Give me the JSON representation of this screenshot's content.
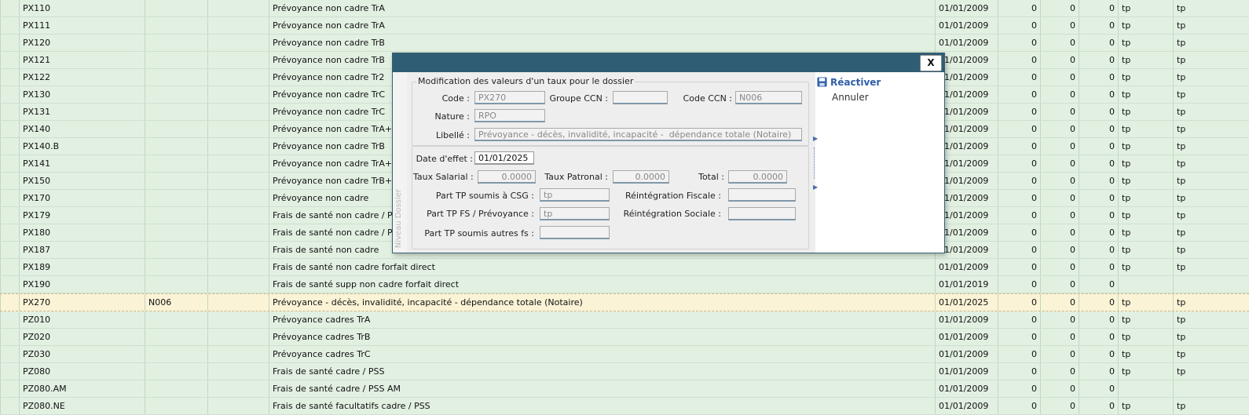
{
  "grid": {
    "rows": [
      {
        "code": "PX110",
        "ccn": "",
        "libelle": "Prévoyance non cadre TrA",
        "date": "01/01/2009",
        "v1": "0",
        "v2": "0",
        "v3": "0",
        "t1": "tp",
        "t2": "tp"
      },
      {
        "code": "PX111",
        "ccn": "",
        "libelle": "Prévoyance non cadre TrA",
        "date": "01/01/2009",
        "v1": "0",
        "v2": "0",
        "v3": "0",
        "t1": "tp",
        "t2": "tp"
      },
      {
        "code": "PX120",
        "ccn": "",
        "libelle": "Prévoyance non cadre TrB",
        "date": "01/01/2009",
        "v1": "0",
        "v2": "0",
        "v3": "0",
        "t1": "tp",
        "t2": "tp"
      },
      {
        "code": "PX121",
        "ccn": "",
        "libelle": "Prévoyance non cadre TrB",
        "date": "01/01/2009",
        "v1": "0",
        "v2": "0",
        "v3": "0",
        "t1": "tp",
        "t2": "tp"
      },
      {
        "code": "PX122",
        "ccn": "",
        "libelle": "Prévoyance non cadre Tr2",
        "date": "01/01/2009",
        "v1": "0",
        "v2": "0",
        "v3": "0",
        "t1": "tp",
        "t2": "tp"
      },
      {
        "code": "PX130",
        "ccn": "",
        "libelle": "Prévoyance non cadre TrC",
        "date": "01/01/2009",
        "v1": "0",
        "v2": "0",
        "v3": "0",
        "t1": "tp",
        "t2": "tp"
      },
      {
        "code": "PX131",
        "ccn": "",
        "libelle": "Prévoyance non cadre TrC",
        "date": "01/01/2009",
        "v1": "0",
        "v2": "0",
        "v3": "0",
        "t1": "tp",
        "t2": "tp"
      },
      {
        "code": "PX140",
        "ccn": "",
        "libelle": "Prévoyance non cadre TrA+TrB",
        "date": "01/01/2009",
        "v1": "0",
        "v2": "0",
        "v3": "0",
        "t1": "tp",
        "t2": "tp"
      },
      {
        "code": "PX140.B",
        "ccn": "",
        "libelle": "Prévoyance non cadre TrB",
        "date": "01/01/2009",
        "v1": "0",
        "v2": "0",
        "v3": "0",
        "t1": "tp",
        "t2": "tp"
      },
      {
        "code": "PX141",
        "ccn": "",
        "libelle": "Prévoyance non cadre TrA+TrB",
        "date": "01/01/2009",
        "v1": "0",
        "v2": "0",
        "v3": "0",
        "t1": "tp",
        "t2": "tp"
      },
      {
        "code": "PX150",
        "ccn": "",
        "libelle": "Prévoyance non cadre TrB+TrC",
        "date": "01/01/2009",
        "v1": "0",
        "v2": "0",
        "v3": "0",
        "t1": "tp",
        "t2": "tp"
      },
      {
        "code": "PX170",
        "ccn": "",
        "libelle": "Prévoyance non cadre",
        "date": "01/01/2009",
        "v1": "0",
        "v2": "0",
        "v3": "0",
        "t1": "tp",
        "t2": "tp"
      },
      {
        "code": "PX179",
        "ccn": "",
        "libelle": "Frais de santé non cadre / PSS",
        "date": "01/01/2009",
        "v1": "0",
        "v2": "0",
        "v3": "0",
        "t1": "tp",
        "t2": "tp"
      },
      {
        "code": "PX180",
        "ccn": "",
        "libelle": "Frais de santé non cadre / PSS",
        "date": "01/01/2009",
        "v1": "0",
        "v2": "0",
        "v3": "0",
        "t1": "tp",
        "t2": "tp"
      },
      {
        "code": "PX187",
        "ccn": "",
        "libelle": "Frais de santé non cadre",
        "date": "01/01/2009",
        "v1": "0",
        "v2": "0",
        "v3": "0",
        "t1": "tp",
        "t2": "tp"
      },
      {
        "code": "PX189",
        "ccn": "",
        "libelle": "Frais de santé non cadre forfait direct",
        "date": "01/01/2009",
        "v1": "0",
        "v2": "0",
        "v3": "0",
        "t1": "tp",
        "t2": "tp"
      },
      {
        "code": "PX190",
        "ccn": "",
        "libelle": "Frais de santé supp non cadre forfait direct",
        "date": "01/01/2019",
        "v1": "0",
        "v2": "0",
        "v3": "0",
        "t1": "",
        "t2": ""
      },
      {
        "code": "PX270",
        "ccn": "N006",
        "libelle": "Prévoyance - décès, invalidité, incapacité -  dépendance totale (Notaire)",
        "date": "01/01/2025",
        "v1": "0",
        "v2": "0",
        "v3": "0",
        "t1": "tp",
        "t2": "tp",
        "selected": true
      },
      {
        "code": "PZ010",
        "ccn": "",
        "libelle": "Prévoyance cadres TrA",
        "date": "01/01/2009",
        "v1": "0",
        "v2": "0",
        "v3": "0",
        "t1": "tp",
        "t2": "tp"
      },
      {
        "code": "PZ020",
        "ccn": "",
        "libelle": "Prévoyance cadres TrB",
        "date": "01/01/2009",
        "v1": "0",
        "v2": "0",
        "v3": "0",
        "t1": "tp",
        "t2": "tp"
      },
      {
        "code": "PZ030",
        "ccn": "",
        "libelle": "Prévoyance cadres TrC",
        "date": "01/01/2009",
        "v1": "0",
        "v2": "0",
        "v3": "0",
        "t1": "tp",
        "t2": "tp"
      },
      {
        "code": "PZ080",
        "ccn": "",
        "libelle": "Frais de santé cadre / PSS",
        "date": "01/01/2009",
        "v1": "0",
        "v2": "0",
        "v3": "0",
        "t1": "tp",
        "t2": "tp"
      },
      {
        "code": "PZ080.AM",
        "ccn": "",
        "libelle": "Frais de santé cadre / PSS AM",
        "date": "01/01/2009",
        "v1": "0",
        "v2": "0",
        "v3": "0",
        "t1": "",
        "t2": ""
      },
      {
        "code": "PZ080.NE",
        "ccn": "",
        "libelle": "Frais de santé facultatifs cadre / PSS",
        "date": "01/01/2009",
        "v1": "0",
        "v2": "0",
        "v3": "0",
        "t1": "tp",
        "t2": "tp"
      }
    ]
  },
  "dialog": {
    "close_label": "X",
    "side_tab_label": "Niveau Dossier",
    "legend": "Modification des valeurs d'un taux pour le dossier",
    "code_label": "Code :",
    "code_value": "PX270",
    "groupe_ccn_label": "Groupe CCN :",
    "groupe_ccn_value": "",
    "code_ccn_label": "Code CCN :",
    "code_ccn_value": "N006",
    "nature_label": "Nature :",
    "nature_value": "RPO",
    "libelle_label": "Libellé :",
    "libelle_value": "Prévoyance - décès, invalidité, incapacité -  dépendance totale (Notaire)",
    "date_effet_label": "Date d'effet :",
    "date_effet_value": "01/01/2025",
    "taux_salarial_label": "Taux Salarial :",
    "taux_salarial_value": "0.0000",
    "taux_patronal_label": "Taux Patronal :",
    "taux_patronal_value": "0.0000",
    "total_label": "Total :",
    "total_value": "0.0000",
    "part_tp_csg_label": "Part TP soumis à CSG :",
    "part_tp_csg_value": "tp",
    "part_tp_fs_label": "Part TP FS / Prévoyance :",
    "part_tp_fs_value": "tp",
    "part_tp_autres_label": "Part TP soumis autres fs :",
    "part_tp_autres_value": "",
    "reint_fiscale_label": "Réintégration Fiscale :",
    "reint_fiscale_value": "",
    "reint_sociale_label": "Réintégration Sociale :",
    "reint_sociale_value": "",
    "reactiver_label": "Réactiver",
    "annuler_label": "Annuler"
  },
  "colors": {
    "titlebar": "#2f5e74",
    "row_bg": "#e2f0e2",
    "selected_row_bg": "#fbf3d6",
    "action_link": "#2f5da8"
  },
  "icons": {
    "reactiver": "save-disk-icon",
    "close": "close-icon"
  }
}
